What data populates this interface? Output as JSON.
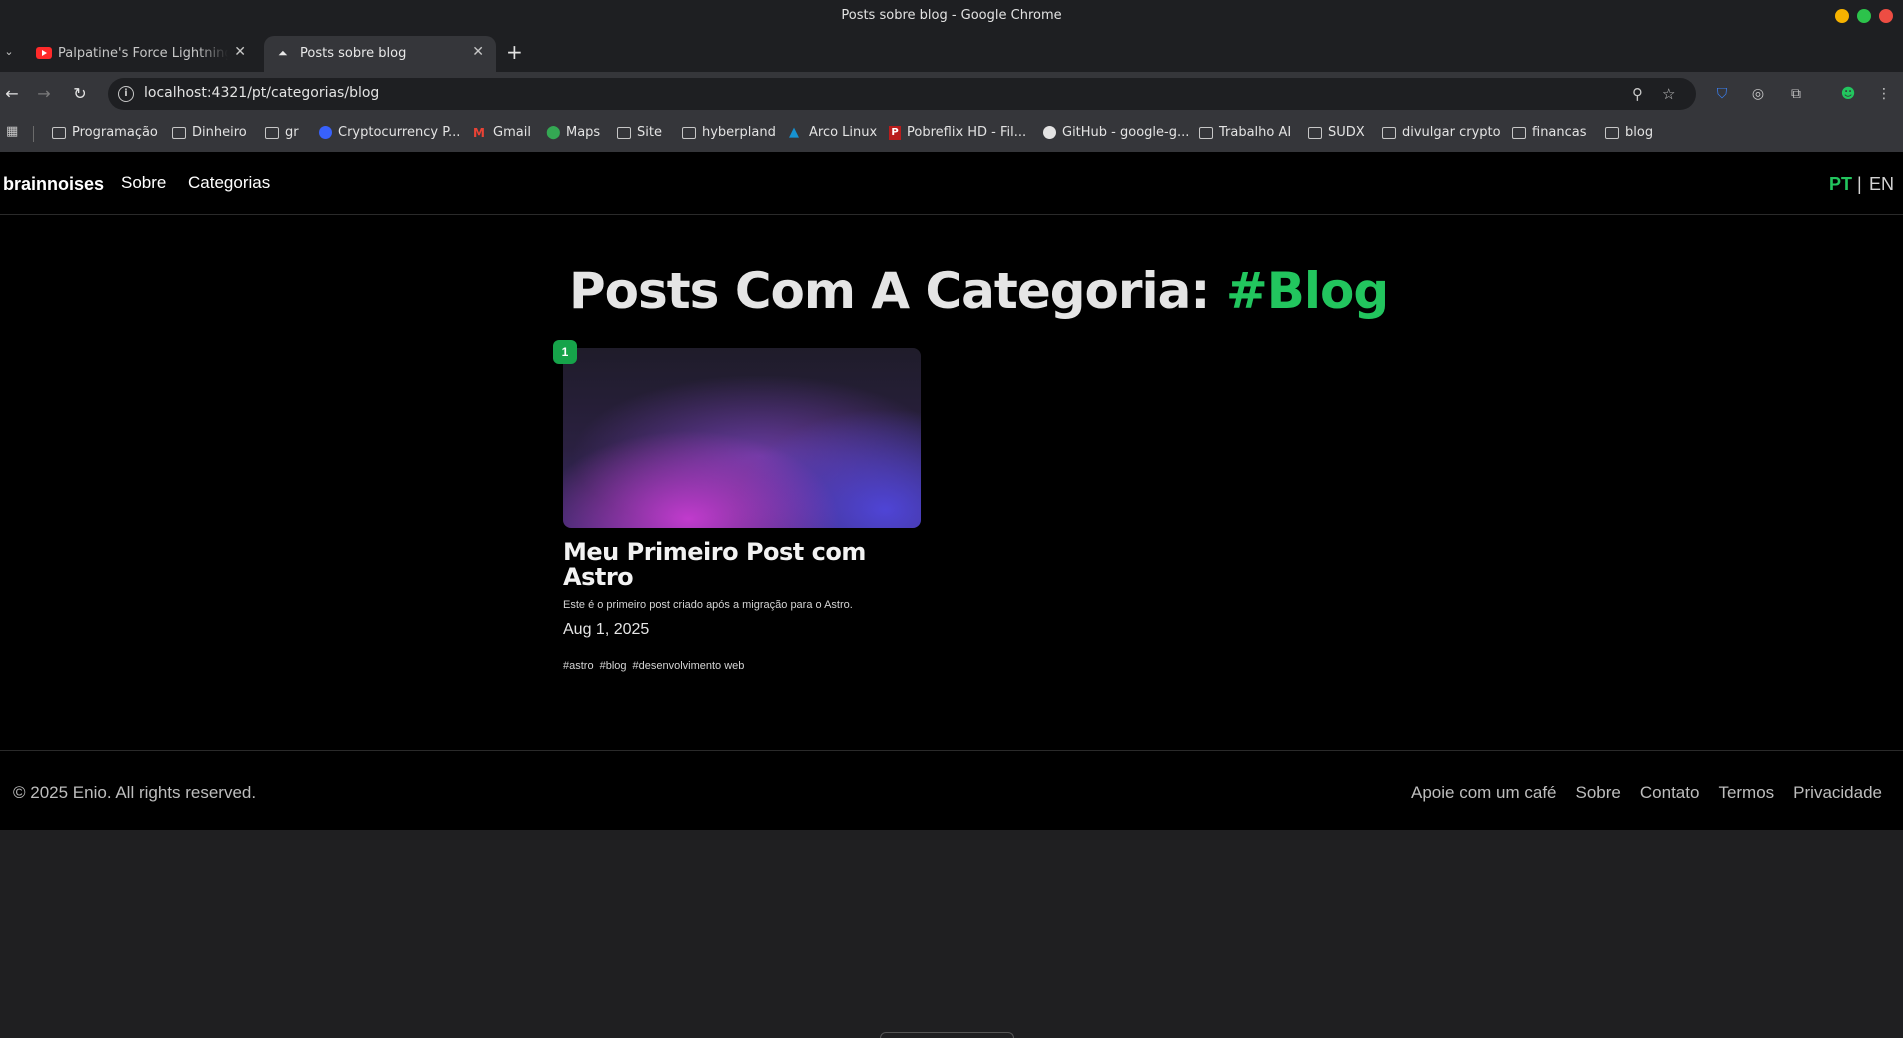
{
  "window": {
    "title": "Posts sobre blog - Google Chrome"
  },
  "tabs": [
    {
      "title": "Palpatine's Force Lightning A",
      "favicon": "youtube-icon",
      "active": false
    },
    {
      "title": "Posts sobre blog",
      "favicon": "astro-icon",
      "active": true
    }
  ],
  "address_bar": {
    "url": "localhost:4321/pt/categorias/blog"
  },
  "bookmarks": [
    {
      "label": "Programação",
      "icon": "folder-icon"
    },
    {
      "label": "Dinheiro",
      "icon": "folder-icon"
    },
    {
      "label": "gr",
      "icon": "folder-icon"
    },
    {
      "label": "Cryptocurrency P...",
      "icon": "coinmarketcap-icon"
    },
    {
      "label": "Gmail",
      "icon": "gmail-icon"
    },
    {
      "label": "Maps",
      "icon": "maps-icon"
    },
    {
      "label": "Site",
      "icon": "folder-icon"
    },
    {
      "label": "hyberpland",
      "icon": "folder-icon"
    },
    {
      "label": "Arco Linux",
      "icon": "arco-icon"
    },
    {
      "label": "Pobreflix HD - Fil...",
      "icon": "pobreflix-icon"
    },
    {
      "label": "GitHub - google-g...",
      "icon": "github-icon"
    },
    {
      "label": "Trabalho AI",
      "icon": "folder-icon"
    },
    {
      "label": "SUDX",
      "icon": "folder-icon"
    },
    {
      "label": "divulgar crypto",
      "icon": "folder-icon"
    },
    {
      "label": "financas",
      "icon": "folder-icon"
    },
    {
      "label": "blog",
      "icon": "folder-icon"
    }
  ],
  "site": {
    "brand": "brainnoises",
    "nav": {
      "about": "Sobre",
      "categories": "Categorias"
    },
    "lang": {
      "pt": "PT",
      "separator": "|",
      "en": "EN"
    },
    "heading": {
      "prefix": "Posts Com A Categoria:",
      "category": "#Blog"
    },
    "posts": [
      {
        "index": "1",
        "title": "Meu Primeiro Post com Astro",
        "description": "Este é o primeiro post criado após a migração para o Astro.",
        "date": "Aug 1, 2025",
        "tags": [
          "#astro",
          "#blog",
          "#desenvolvimento web"
        ]
      }
    ],
    "footer": {
      "copyright": "© 2025 Enio. All rights reserved.",
      "links": [
        "Apoie com um café",
        "Sobre",
        "Contato",
        "Termos",
        "Privacidade"
      ]
    }
  },
  "colors": {
    "accent": "#22c55e",
    "badge": "#16a34a",
    "page_bg": "#000000"
  }
}
